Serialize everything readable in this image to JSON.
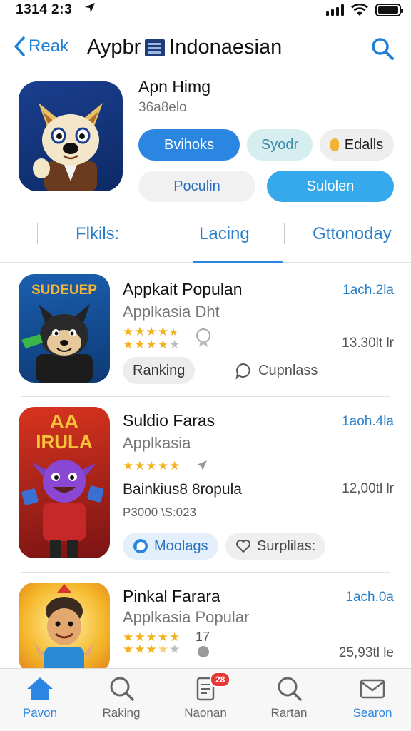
{
  "status_bar": {
    "time": "1314 2:3",
    "location_arrow": "location-arrow-icon"
  },
  "nav": {
    "back_label": "Reak",
    "title_prefix": "Aypbr",
    "title_suffix": "Indonaesian"
  },
  "app_header": {
    "name": "Apn Himg",
    "subtitle": "36a8elo",
    "chips": {
      "primary": "Bvihoks",
      "teal": "Syodr",
      "coins": "Edalls",
      "popular": "Poculin",
      "action": "Sulolen"
    }
  },
  "tabs": [
    {
      "label": "Flkils:"
    },
    {
      "label": "Lacing"
    },
    {
      "label": "Gttonoday"
    }
  ],
  "list": [
    {
      "icon_text": "SUDEUEP",
      "title": "Appkait Populan",
      "subtitle": "Applkasia Dht",
      "price": "1ach.2la",
      "size": "13.30lt lr",
      "rating_rows": [
        4.5,
        4
      ],
      "chips": [
        "Ranking",
        "Cupnlass"
      ]
    },
    {
      "icon_text_top": "AA",
      "icon_text_bottom": "IRULA",
      "title": "Suldio Faras",
      "subtitle": "Applkasia",
      "price": "1aoh.4la",
      "size": "12,00tl lr",
      "rating_rows": [
        5
      ],
      "extra": "Bainkius8 8ropula",
      "small": "P3000 \\S:023",
      "chips": [
        "Moolags",
        "Surplilas:"
      ]
    },
    {
      "title": "Pinkal Farara",
      "subtitle": "Applkasia Popular",
      "price": "1ach.0a",
      "size": "25,93tl le",
      "rating_rows": [
        5,
        3.5
      ],
      "count": "17"
    }
  ],
  "tabbar": {
    "items": [
      {
        "label": "Pavon",
        "icon": "home-icon"
      },
      {
        "label": "Raking",
        "icon": "search-icon"
      },
      {
        "label": "Naonan",
        "icon": "document-icon",
        "badge": "28"
      },
      {
        "label": "Rartan",
        "icon": "search-icon"
      },
      {
        "label": "Searon",
        "icon": "mail-icon"
      }
    ]
  },
  "colors": {
    "accent": "#2a86e0",
    "link": "#2a7fc8",
    "star": "#f2b21e",
    "badge": "#e53935"
  }
}
